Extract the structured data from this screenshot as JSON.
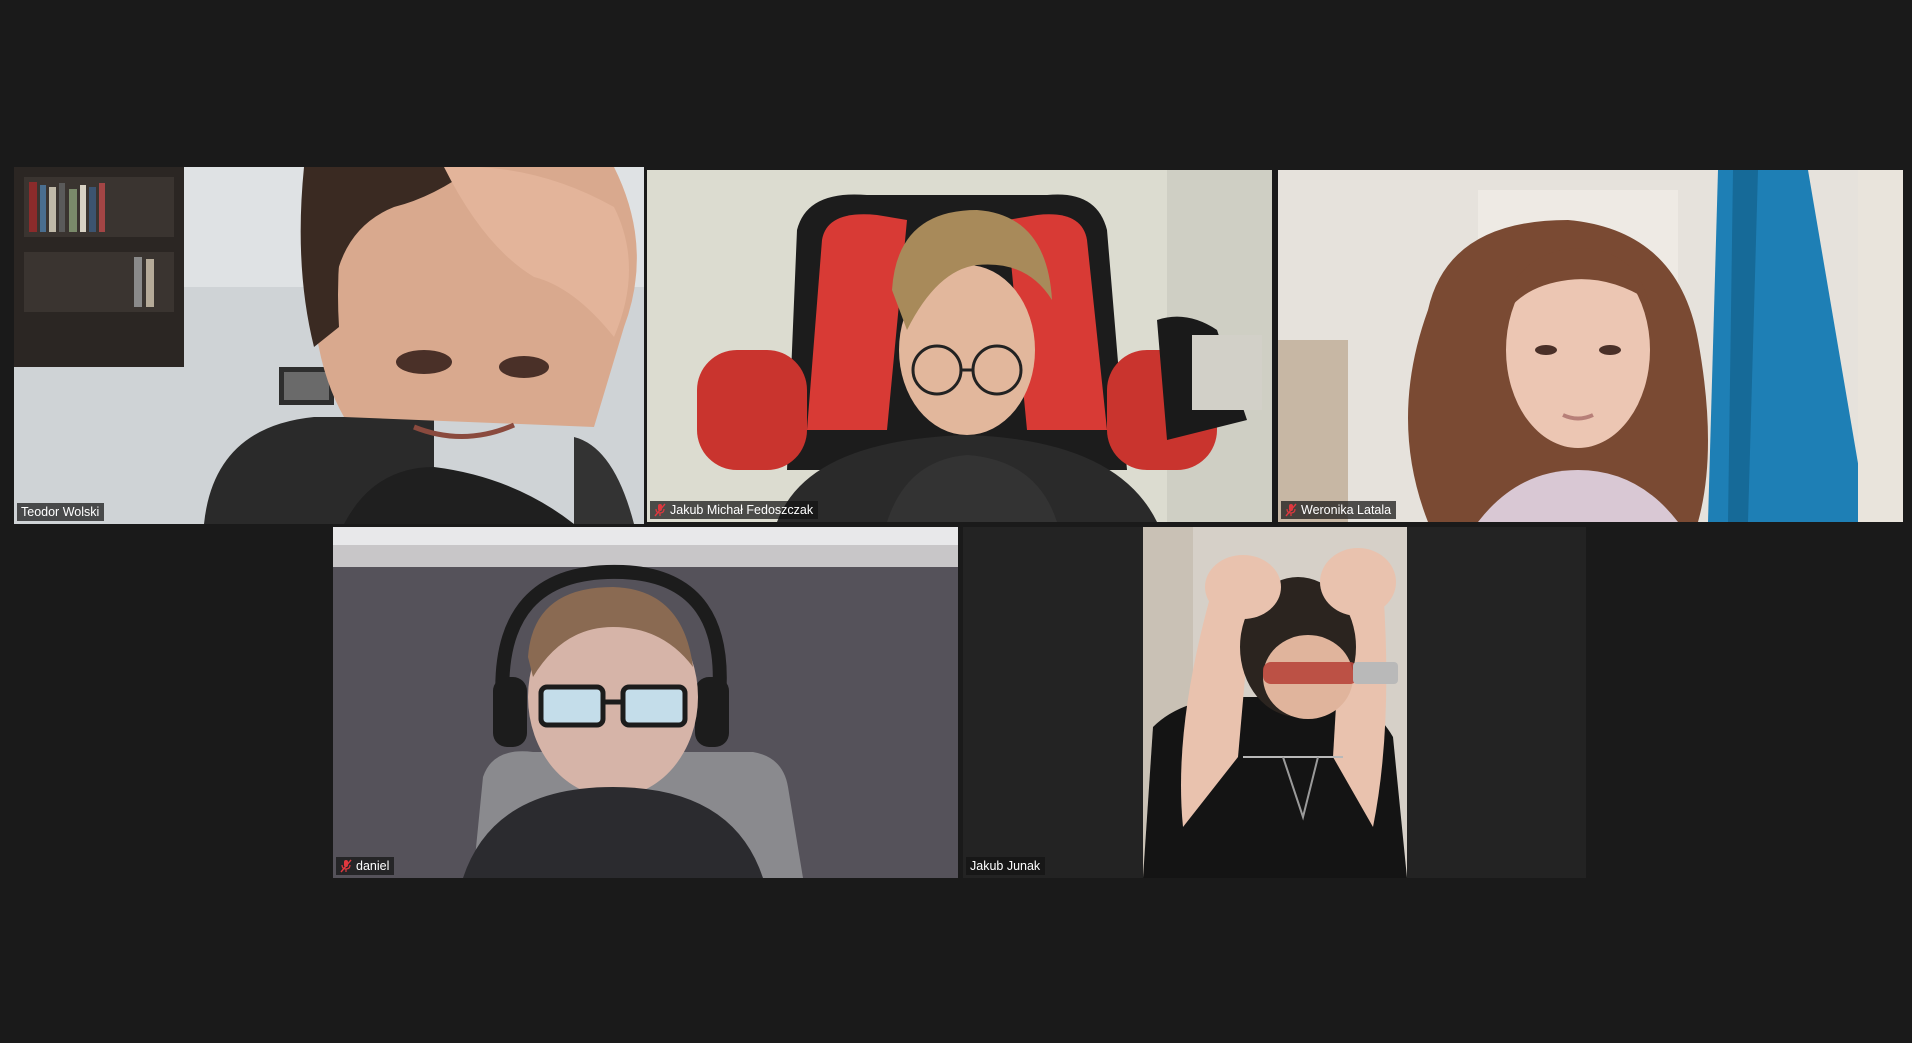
{
  "meeting": {
    "active_speaker": "Teodor Wolski",
    "accent_color": "#d9e58a",
    "background_color": "#1a1a1a"
  },
  "participants": [
    {
      "name": "Teodor Wolski",
      "muted": false,
      "video_on": true,
      "speaking": true
    },
    {
      "name": "Jakub Michał Fedoszczak",
      "muted": true,
      "video_on": true,
      "speaking": false
    },
    {
      "name": "Weronika Latala",
      "muted": true,
      "video_on": true,
      "speaking": false
    },
    {
      "name": "daniel",
      "muted": true,
      "video_on": true,
      "speaking": false
    },
    {
      "name": "Jakub Junak",
      "muted": false,
      "video_on": true,
      "speaking": false
    }
  ],
  "icons": {
    "muted_mic": "mic-off-icon",
    "mute_color": "#e0383e"
  }
}
